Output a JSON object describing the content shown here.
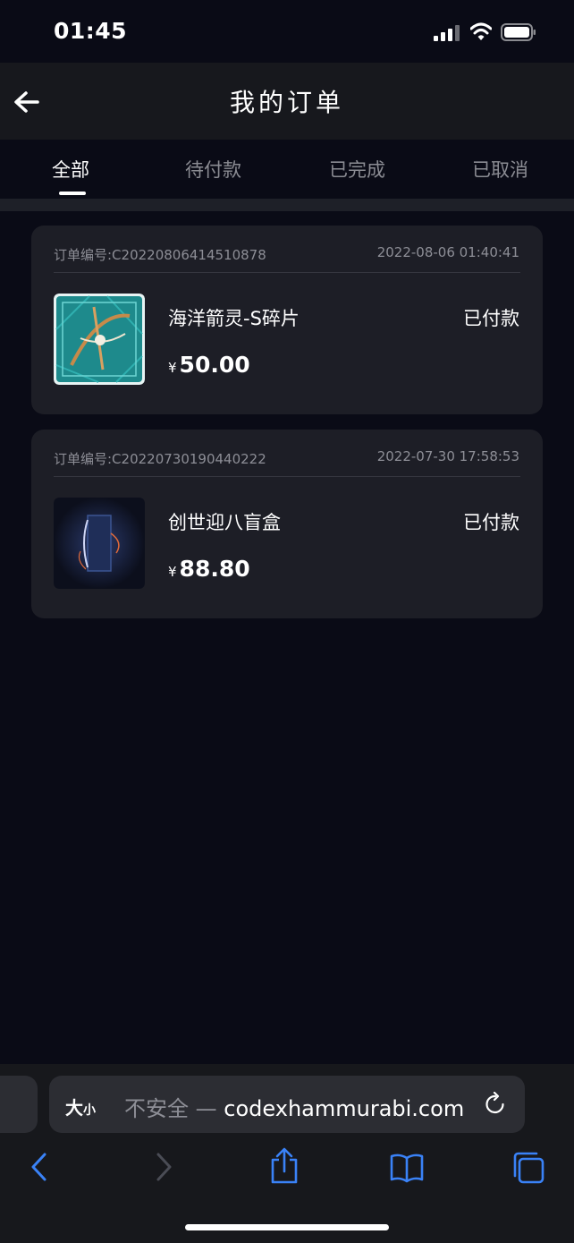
{
  "status_bar": {
    "time": "01:45"
  },
  "header": {
    "title": "我的订单"
  },
  "tabs": [
    {
      "label": "全部",
      "active": true
    },
    {
      "label": "待付款",
      "active": false
    },
    {
      "label": "已完成",
      "active": false
    },
    {
      "label": "已取消",
      "active": false
    }
  ],
  "orders": [
    {
      "order_no": "订单编号:C20220806414510878",
      "time": "2022-08-06 01:40:41",
      "product_name": "海洋箭灵-S碎片",
      "status": "已付款",
      "currency": "¥",
      "price": "50.00"
    },
    {
      "order_no": "订单编号:C20220730190440222",
      "time": "2022-07-30 17:58:53",
      "product_name": "创世迎八盲盒",
      "status": "已付款",
      "currency": "¥",
      "price": "88.80"
    }
  ],
  "browser": {
    "text_size_big": "大",
    "text_size_small": "小",
    "insecure_label": "不安全 —",
    "domain": "codexhammurabi.com"
  },
  "colors": {
    "background": "#0a0b16",
    "card": "#1d1e26",
    "accent_blue": "#3a82f7"
  },
  "icons": [
    "back-icon",
    "signal-icon",
    "wifi-icon",
    "battery-icon",
    "reload-icon",
    "back-arrow-icon",
    "forward-arrow-icon",
    "share-icon",
    "bookmarks-icon",
    "tabs-icon"
  ]
}
